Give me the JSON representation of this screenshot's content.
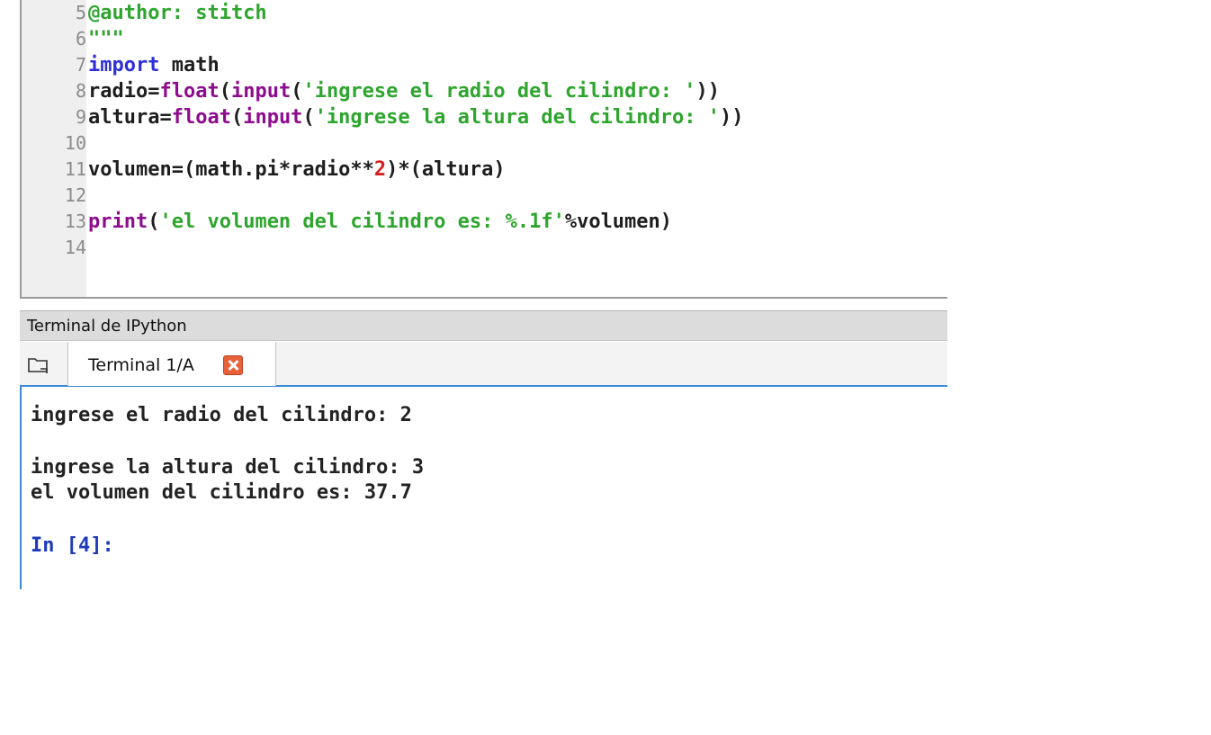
{
  "editor": {
    "lines": [
      {
        "num": "5",
        "tokens": [
          {
            "t": "@author: stitch",
            "c": "str"
          }
        ]
      },
      {
        "num": "6",
        "tokens": [
          {
            "t": "\"\"\"",
            "c": "str"
          }
        ]
      },
      {
        "num": "7",
        "tokens": [
          {
            "t": "import",
            "c": "kw"
          },
          {
            "t": " math",
            "c": "plain"
          }
        ]
      },
      {
        "num": "8",
        "tokens": [
          {
            "t": "radio=",
            "c": "plain"
          },
          {
            "t": "float",
            "c": "builtin"
          },
          {
            "t": "(",
            "c": "plain"
          },
          {
            "t": "input",
            "c": "builtin"
          },
          {
            "t": "(",
            "c": "plain"
          },
          {
            "t": "'ingrese el radio del cilindro: '",
            "c": "str"
          },
          {
            "t": "))",
            "c": "plain"
          }
        ]
      },
      {
        "num": "9",
        "tokens": [
          {
            "t": "altura=",
            "c": "plain"
          },
          {
            "t": "float",
            "c": "builtin"
          },
          {
            "t": "(",
            "c": "plain"
          },
          {
            "t": "input",
            "c": "builtin"
          },
          {
            "t": "(",
            "c": "plain"
          },
          {
            "t": "'ingrese la altura del cilindro: '",
            "c": "str"
          },
          {
            "t": "))",
            "c": "plain"
          }
        ]
      },
      {
        "num": "10",
        "tokens": []
      },
      {
        "num": "11",
        "tokens": [
          {
            "t": "volumen=(math.pi*radio**",
            "c": "plain"
          },
          {
            "t": "2",
            "c": "num"
          },
          {
            "t": ")*(altura)",
            "c": "plain"
          }
        ]
      },
      {
        "num": "12",
        "tokens": []
      },
      {
        "num": "13",
        "tokens": [
          {
            "t": "print",
            "c": "builtin"
          },
          {
            "t": "(",
            "c": "plain"
          },
          {
            "t": "'el volumen del cilindro es: %.1f'",
            "c": "str"
          },
          {
            "t": "%volumen)",
            "c": "plain"
          }
        ]
      },
      {
        "num": "14",
        "tokens": []
      }
    ]
  },
  "terminal_pane": {
    "title": "Terminal de IPython",
    "tab_label": "Terminal 1/A"
  },
  "console": {
    "output_1": "ingrese el radio del cilindro: 2",
    "output_2": "ingrese la altura del cilindro: 3",
    "output_3": "el volumen del cilindro es: 37.7",
    "prompt": "In [4]:"
  },
  "colors": {
    "keyword": "#2f2fd9",
    "builtin": "#8e0c8e",
    "string": "#2ea52e",
    "number": "#d32020",
    "accent_blue": "#3c8ad8",
    "close_orange": "#e8613a"
  }
}
